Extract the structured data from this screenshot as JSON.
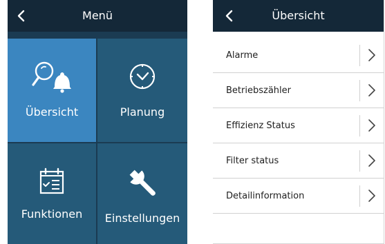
{
  "menu_screen": {
    "title": "Menü",
    "tiles": [
      {
        "label": "Übersicht",
        "icon": "search-bell-icon",
        "active": true
      },
      {
        "label": "Planung",
        "icon": "clock-icon",
        "active": false
      },
      {
        "label": "Funktionen",
        "icon": "calendar-list-icon",
        "active": false
      },
      {
        "label": "Einstellungen",
        "icon": "wrench-icon",
        "active": false
      }
    ]
  },
  "overview_screen": {
    "title": "Übersicht",
    "items": [
      {
        "label": "Alarme"
      },
      {
        "label": "Betriebszähler"
      },
      {
        "label": "Effizienz Status"
      },
      {
        "label": "Filter status"
      },
      {
        "label": "Detailinformation"
      }
    ]
  },
  "colors": {
    "header_bg": "#142838",
    "panel_bg": "#1b3b52",
    "tile_bg": "#255a79",
    "tile_active_bg": "#3b86c0",
    "text_light": "#ffffff",
    "text_dark": "#1e1e1e",
    "divider": "#d0d0d0"
  }
}
